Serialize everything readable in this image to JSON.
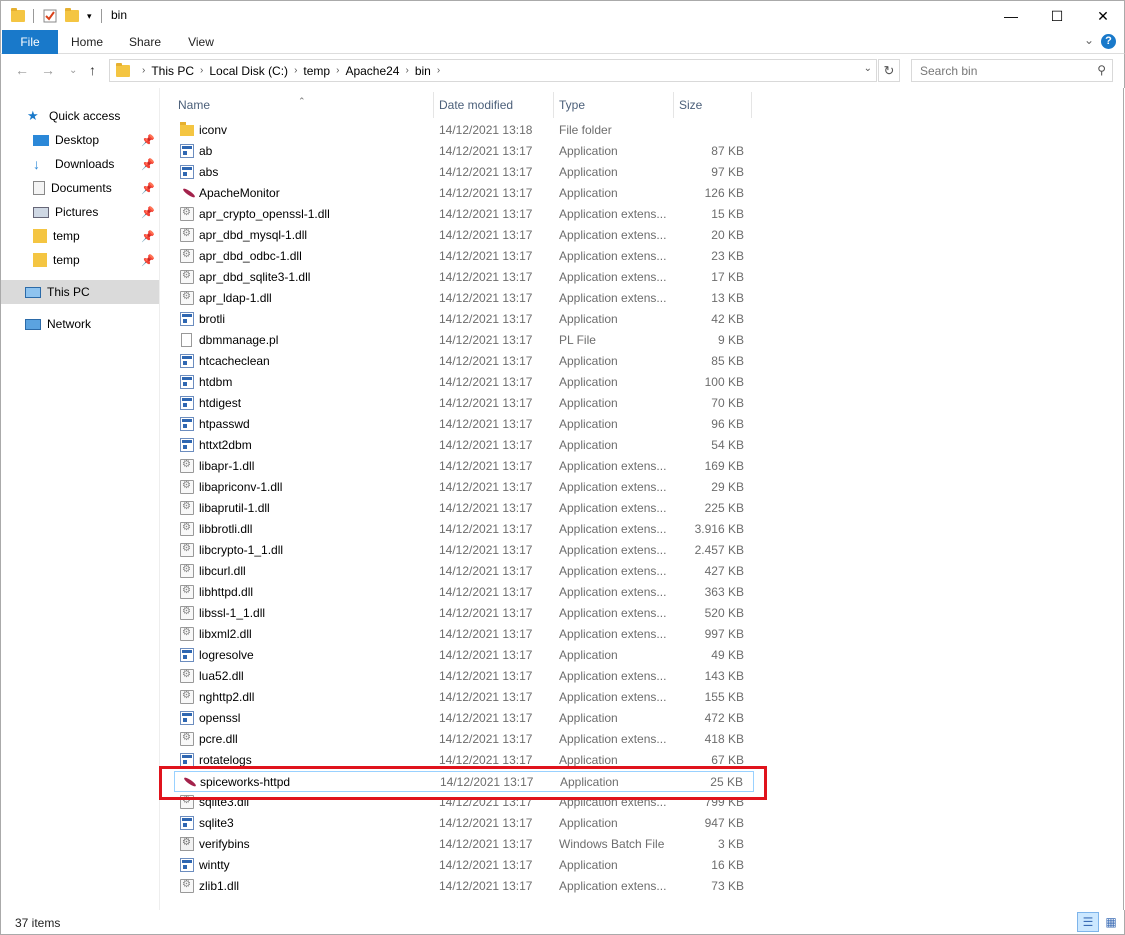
{
  "window": {
    "title": "bin",
    "minimize_glyph": "—",
    "maximize_glyph": "☐",
    "close_glyph": "✕"
  },
  "ribbon": {
    "tabs": [
      "File",
      "Home",
      "Share",
      "View"
    ],
    "help": "?",
    "expand": "⌄"
  },
  "address": {
    "crumbs": [
      "This PC",
      "Local Disk (C:)",
      "temp",
      "Apache24",
      "bin"
    ],
    "search_placeholder": "Search bin"
  },
  "nav": {
    "back": "←",
    "forward": "→",
    "recent": "⌄",
    "up": "↑",
    "items": [
      {
        "label": "Quick access",
        "icon": "star-icon",
        "pinned": false
      },
      {
        "label": "Desktop",
        "icon": "desktop-icon",
        "pinned": true
      },
      {
        "label": "Downloads",
        "icon": "downloads-icon",
        "pinned": true
      },
      {
        "label": "Documents",
        "icon": "documents-icon",
        "pinned": true
      },
      {
        "label": "Pictures",
        "icon": "pictures-icon",
        "pinned": true
      },
      {
        "label": "temp",
        "icon": "folder-icon",
        "pinned": true
      },
      {
        "label": "temp",
        "icon": "folder-icon",
        "pinned": true
      },
      {
        "label": "This PC",
        "icon": "computer-icon",
        "pinned": false
      },
      {
        "label": "Network",
        "icon": "network-icon",
        "pinned": false
      }
    ]
  },
  "columns": {
    "name": "Name",
    "date": "Date modified",
    "type": "Type",
    "size": "Size"
  },
  "files": [
    {
      "name": "iconv",
      "date": "14/12/2021 13:18",
      "type": "File folder",
      "size": "",
      "icon": "folder"
    },
    {
      "name": "ab",
      "date": "14/12/2021 13:17",
      "type": "Application",
      "size": "87 KB",
      "icon": "app"
    },
    {
      "name": "abs",
      "date": "14/12/2021 13:17",
      "type": "Application",
      "size": "97 KB",
      "icon": "app"
    },
    {
      "name": "ApacheMonitor",
      "date": "14/12/2021 13:17",
      "type": "Application",
      "size": "126 KB",
      "icon": "feather"
    },
    {
      "name": "apr_crypto_openssl-1.dll",
      "date": "14/12/2021 13:17",
      "type": "Application extens...",
      "size": "15 KB",
      "icon": "dll"
    },
    {
      "name": "apr_dbd_mysql-1.dll",
      "date": "14/12/2021 13:17",
      "type": "Application extens...",
      "size": "20 KB",
      "icon": "dll"
    },
    {
      "name": "apr_dbd_odbc-1.dll",
      "date": "14/12/2021 13:17",
      "type": "Application extens...",
      "size": "23 KB",
      "icon": "dll"
    },
    {
      "name": "apr_dbd_sqlite3-1.dll",
      "date": "14/12/2021 13:17",
      "type": "Application extens...",
      "size": "17 KB",
      "icon": "dll"
    },
    {
      "name": "apr_ldap-1.dll",
      "date": "14/12/2021 13:17",
      "type": "Application extens...",
      "size": "13 KB",
      "icon": "dll"
    },
    {
      "name": "brotli",
      "date": "14/12/2021 13:17",
      "type": "Application",
      "size": "42 KB",
      "icon": "app"
    },
    {
      "name": "dbmmanage.pl",
      "date": "14/12/2021 13:17",
      "type": "PL File",
      "size": "9 KB",
      "icon": "file"
    },
    {
      "name": "htcacheclean",
      "date": "14/12/2021 13:17",
      "type": "Application",
      "size": "85 KB",
      "icon": "app"
    },
    {
      "name": "htdbm",
      "date": "14/12/2021 13:17",
      "type": "Application",
      "size": "100 KB",
      "icon": "app"
    },
    {
      "name": "htdigest",
      "date": "14/12/2021 13:17",
      "type": "Application",
      "size": "70 KB",
      "icon": "app"
    },
    {
      "name": "htpasswd",
      "date": "14/12/2021 13:17",
      "type": "Application",
      "size": "96 KB",
      "icon": "app"
    },
    {
      "name": "httxt2dbm",
      "date": "14/12/2021 13:17",
      "type": "Application",
      "size": "54 KB",
      "icon": "app"
    },
    {
      "name": "libapr-1.dll",
      "date": "14/12/2021 13:17",
      "type": "Application extens...",
      "size": "169 KB",
      "icon": "dll"
    },
    {
      "name": "libapriconv-1.dll",
      "date": "14/12/2021 13:17",
      "type": "Application extens...",
      "size": "29 KB",
      "icon": "dll"
    },
    {
      "name": "libaprutil-1.dll",
      "date": "14/12/2021 13:17",
      "type": "Application extens...",
      "size": "225 KB",
      "icon": "dll"
    },
    {
      "name": "libbrotli.dll",
      "date": "14/12/2021 13:17",
      "type": "Application extens...",
      "size": "3.916 KB",
      "icon": "dll"
    },
    {
      "name": "libcrypto-1_1.dll",
      "date": "14/12/2021 13:17",
      "type": "Application extens...",
      "size": "2.457 KB",
      "icon": "dll"
    },
    {
      "name": "libcurl.dll",
      "date": "14/12/2021 13:17",
      "type": "Application extens...",
      "size": "427 KB",
      "icon": "dll"
    },
    {
      "name": "libhttpd.dll",
      "date": "14/12/2021 13:17",
      "type": "Application extens...",
      "size": "363 KB",
      "icon": "dll"
    },
    {
      "name": "libssl-1_1.dll",
      "date": "14/12/2021 13:17",
      "type": "Application extens...",
      "size": "520 KB",
      "icon": "dll"
    },
    {
      "name": "libxml2.dll",
      "date": "14/12/2021 13:17",
      "type": "Application extens...",
      "size": "997 KB",
      "icon": "dll"
    },
    {
      "name": "logresolve",
      "date": "14/12/2021 13:17",
      "type": "Application",
      "size": "49 KB",
      "icon": "app"
    },
    {
      "name": "lua52.dll",
      "date": "14/12/2021 13:17",
      "type": "Application extens...",
      "size": "143 KB",
      "icon": "dll"
    },
    {
      "name": "nghttp2.dll",
      "date": "14/12/2021 13:17",
      "type": "Application extens...",
      "size": "155 KB",
      "icon": "dll"
    },
    {
      "name": "openssl",
      "date": "14/12/2021 13:17",
      "type": "Application",
      "size": "472 KB",
      "icon": "app"
    },
    {
      "name": "pcre.dll",
      "date": "14/12/2021 13:17",
      "type": "Application extens...",
      "size": "418 KB",
      "icon": "dll"
    },
    {
      "name": "rotatelogs",
      "date": "14/12/2021 13:17",
      "type": "Application",
      "size": "67 KB",
      "icon": "app"
    },
    {
      "name": "spiceworks-httpd",
      "date": "14/12/2021 13:17",
      "type": "Application",
      "size": "25 KB",
      "icon": "feather",
      "highlighted": true
    },
    {
      "name": "sqlite3.dll",
      "date": "14/12/2021 13:17",
      "type": "Application extens...",
      "size": "799 KB",
      "icon": "dll"
    },
    {
      "name": "sqlite3",
      "date": "14/12/2021 13:17",
      "type": "Application",
      "size": "947 KB",
      "icon": "app"
    },
    {
      "name": "verifybins",
      "date": "14/12/2021 13:17",
      "type": "Windows Batch File",
      "size": "3 KB",
      "icon": "bat"
    },
    {
      "name": "wintty",
      "date": "14/12/2021 13:17",
      "type": "Application",
      "size": "16 KB",
      "icon": "app"
    },
    {
      "name": "zlib1.dll",
      "date": "14/12/2021 13:17",
      "type": "Application extens...",
      "size": "73 KB",
      "icon": "dll"
    }
  ],
  "status": {
    "item_count": "37 items"
  },
  "colors": {
    "accent": "#1979ca",
    "highlight_box": "#e0131c",
    "selection": "#99d1ff"
  }
}
